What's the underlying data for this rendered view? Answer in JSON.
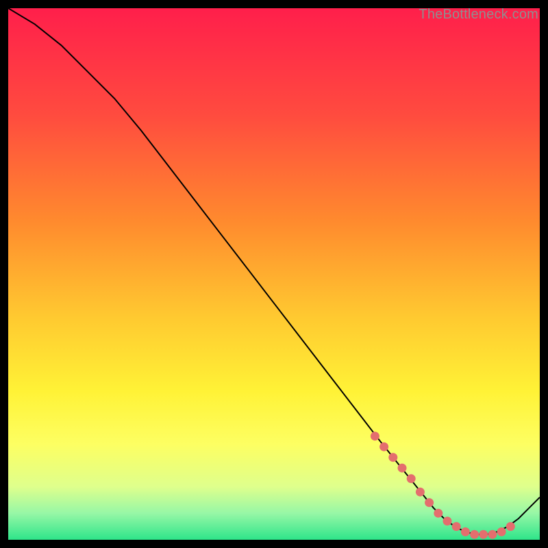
{
  "watermark": "TheBottleneck.com",
  "chart_data": {
    "type": "line",
    "title": "",
    "xlabel": "",
    "ylabel": "",
    "xlim": [
      0,
      100
    ],
    "ylim": [
      0,
      100
    ],
    "grid": false,
    "legend": false,
    "series": [
      {
        "name": "curve",
        "x": [
          0,
          5,
          10,
          15,
          20,
          25,
          30,
          35,
          40,
          45,
          50,
          55,
          60,
          65,
          70,
          72,
          74,
          76,
          78,
          80,
          82,
          84,
          86,
          88,
          90,
          92,
          94,
          96,
          98,
          100
        ],
        "y": [
          100,
          97,
          93,
          88,
          83,
          77,
          70.5,
          64,
          57.5,
          51,
          44.5,
          38,
          31.5,
          25,
          18.5,
          16,
          13.5,
          11,
          8.5,
          6,
          4,
          2.5,
          1.5,
          1,
          1,
          1.5,
          2.5,
          4,
          6,
          8
        ]
      }
    ],
    "highlight": {
      "name": "highlight-dots",
      "color": "#e46e6e",
      "x": [
        69,
        70.7,
        72.4,
        74.1,
        75.8,
        77.5,
        79.2,
        80.9,
        82.6,
        84.3,
        86,
        87.7,
        89.4,
        91.1,
        92.8,
        94.5
      ],
      "y": [
        19.5,
        17.5,
        15.5,
        13.5,
        11.5,
        9,
        7,
        5,
        3.5,
        2.5,
        1.5,
        1,
        1,
        1,
        1.5,
        2.5
      ]
    },
    "gradient_stops": [
      {
        "offset": 0.0,
        "color": "#ff1f4b"
      },
      {
        "offset": 0.2,
        "color": "#ff4b3f"
      },
      {
        "offset": 0.4,
        "color": "#ff8a2e"
      },
      {
        "offset": 0.58,
        "color": "#ffc930"
      },
      {
        "offset": 0.72,
        "color": "#fff236"
      },
      {
        "offset": 0.82,
        "color": "#fdff62"
      },
      {
        "offset": 0.9,
        "color": "#dfff8c"
      },
      {
        "offset": 0.95,
        "color": "#97f7a6"
      },
      {
        "offset": 1.0,
        "color": "#2ee58a"
      }
    ]
  }
}
